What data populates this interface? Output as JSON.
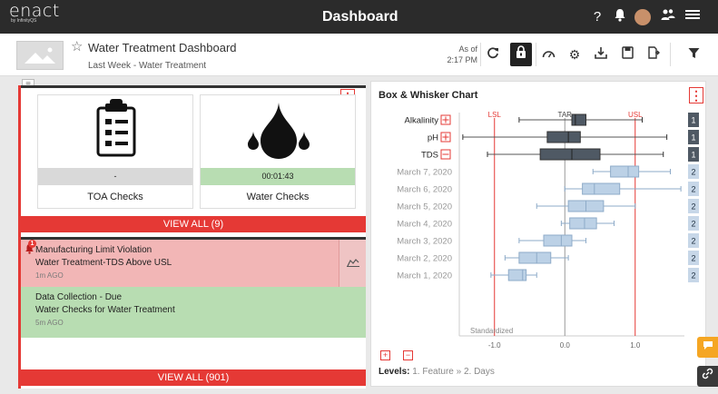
{
  "app": {
    "logo": "enact",
    "logo_sub": "by InfinityQS",
    "title": "Dashboard"
  },
  "topbar_icons": [
    "help-icon",
    "bell-icon",
    "avatar",
    "people-icon",
    "menu-icon"
  ],
  "subheader": {
    "dashboard_title": "Water Treatment Dashboard",
    "dashboard_subtitle": "Last Week - Water Treatment",
    "as_of_label": "As of",
    "as_of_time": "2:17 PM"
  },
  "cards": [
    {
      "strip": "-",
      "label": "TOA Checks",
      "strip_color": "#d9d9d9"
    },
    {
      "strip": "00:01:43",
      "label": "Water Checks",
      "strip_color": "#b8ddb2"
    }
  ],
  "cards_view_all": "VIEW ALL (9)",
  "alert_badge": "1",
  "alerts": [
    {
      "title": "Manufacturing Limit Violation",
      "detail": "Water Treatment-TDS  Above USL",
      "time": "1m AGO"
    },
    {
      "title": "Data Collection - Due",
      "detail": "Water Checks for Water Treatment",
      "time": "5m AGO"
    }
  ],
  "alerts_view_all": "VIEW ALL  (901)",
  "chart": {
    "title": "Box & Whisker Chart",
    "levels_label": "Levels:",
    "levels_value": "1. Feature » 2. Days"
  },
  "chart_data": {
    "type": "boxplot",
    "title": "Box & Whisker Chart",
    "xlabel": "Standardized",
    "xlim": [
      -1.5,
      1.7
    ],
    "xticks": [
      -1.0,
      0.0,
      1.0
    ],
    "tick_labels": [
      "-1.0",
      "0.0",
      "1.0"
    ],
    "reference_lines": [
      {
        "name": "LSL",
        "x": -1.0
      },
      {
        "name": "TAR",
        "x": 0.0
      },
      {
        "name": "USL",
        "x": 1.0
      }
    ],
    "rows": [
      {
        "label": "Alkalinity",
        "level": "1",
        "group": "feature",
        "min": -0.65,
        "q1": 0.1,
        "median": 0.15,
        "q3": 0.3,
        "max": 1.1,
        "outliers": []
      },
      {
        "label": "pH",
        "level": "1",
        "group": "feature",
        "min": -1.45,
        "q1": -0.25,
        "median": 0.05,
        "q3": 0.22,
        "max": 1.45,
        "outliers": []
      },
      {
        "label": "TDS",
        "level": "1",
        "group": "feature",
        "min": -1.1,
        "q1": -0.35,
        "median": 0.1,
        "q3": 0.5,
        "max": 1.4,
        "outliers": []
      },
      {
        "label": "March 7, 2020",
        "level": "2",
        "group": "day",
        "min": 0.4,
        "q1": 0.65,
        "median": 0.9,
        "q3": 1.05,
        "max": 1.5,
        "outliers": []
      },
      {
        "label": "March 6, 2020",
        "level": "2",
        "group": "day",
        "min": 0.0,
        "q1": 0.25,
        "median": 0.42,
        "q3": 0.78,
        "max": 1.65,
        "outliers": []
      },
      {
        "label": "March 5, 2020",
        "level": "2",
        "group": "day",
        "min": -0.4,
        "q1": 0.05,
        "median": 0.3,
        "q3": 0.55,
        "max": 1.0,
        "outliers": []
      },
      {
        "label": "March 4, 2020",
        "level": "2",
        "group": "day",
        "min": -0.05,
        "q1": 0.07,
        "median": 0.28,
        "q3": 0.45,
        "max": 0.7,
        "outliers": []
      },
      {
        "label": "March 3, 2020",
        "level": "2",
        "group": "day",
        "min": -0.65,
        "q1": -0.3,
        "median": -0.05,
        "q3": 0.1,
        "max": 0.3,
        "outliers": []
      },
      {
        "label": "March 2, 2020",
        "level": "2",
        "group": "day",
        "min": -0.85,
        "q1": -0.65,
        "median": -0.4,
        "q3": -0.2,
        "max": 0.05,
        "outliers": []
      },
      {
        "label": "March 1, 2020",
        "level": "2",
        "group": "day",
        "min": -1.05,
        "q1": -0.8,
        "median": -0.6,
        "q3": -0.55,
        "max": -0.4,
        "outliers": []
      }
    ]
  },
  "colors": {
    "accent": "#e53935",
    "feature_box": "#4f5964",
    "day_box": "#bcd1e6",
    "day_stroke": "#8eabc8",
    "alert_red": "#f2b6b6",
    "alert_green": "#b8ddb2",
    "level1_badge": "#4f5964",
    "level2_badge": "#c7d7e8"
  }
}
